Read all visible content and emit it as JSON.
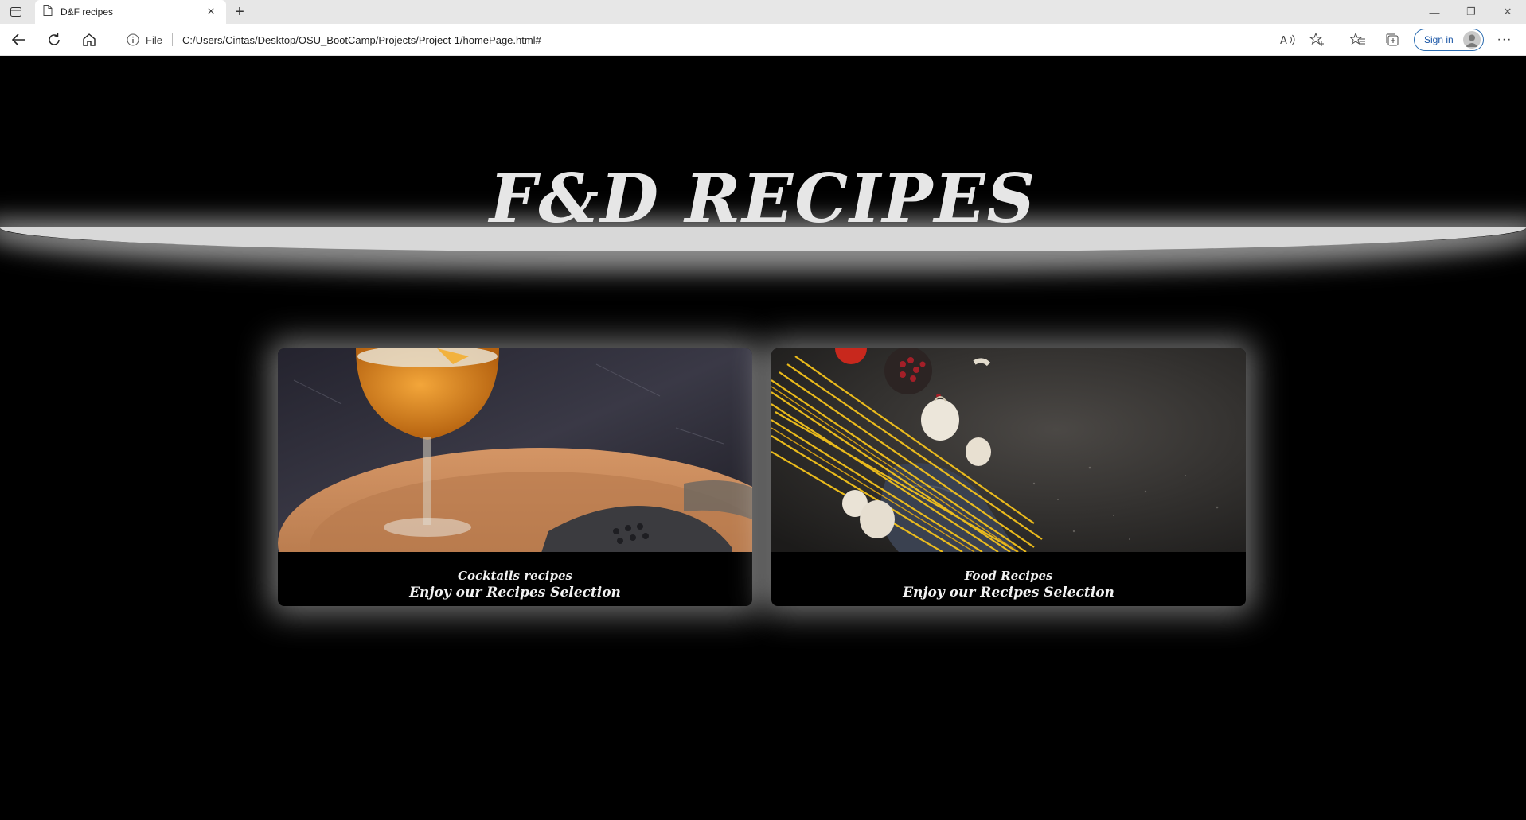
{
  "browser": {
    "tab_title": "D&F recipes",
    "address_prefix": "File",
    "url": "C:/Users/Cintas/Desktop/OSU_BootCamp/Projects/Project-1/homePage.html#",
    "signin_label": "Sign in"
  },
  "page": {
    "title": "F&D RECIPES",
    "cards": [
      {
        "title": "Cocktails recipes",
        "subtitle": "Enjoy our Recipes Selection",
        "image": "cocktail-photo"
      },
      {
        "title": "Food Recipes",
        "subtitle": "Enjoy our Recipes Selection",
        "image": "pasta-ingredients-photo"
      }
    ]
  },
  "icons": {
    "tab_actions": "tab-actions-icon",
    "page": "page-icon",
    "close": "close-icon",
    "new_tab": "plus-icon",
    "back": "back-arrow-icon",
    "reload": "reload-icon",
    "home": "home-icon",
    "info": "info-icon",
    "read_aloud": "read-aloud-icon",
    "add_favorite": "star-plus-icon",
    "favorites": "favorites-icon",
    "collections": "collections-icon",
    "more": "more-icon"
  },
  "colors": {
    "page_bg": "#000000",
    "title": "#e6e6e6",
    "signin_accent": "#1a56a6"
  }
}
